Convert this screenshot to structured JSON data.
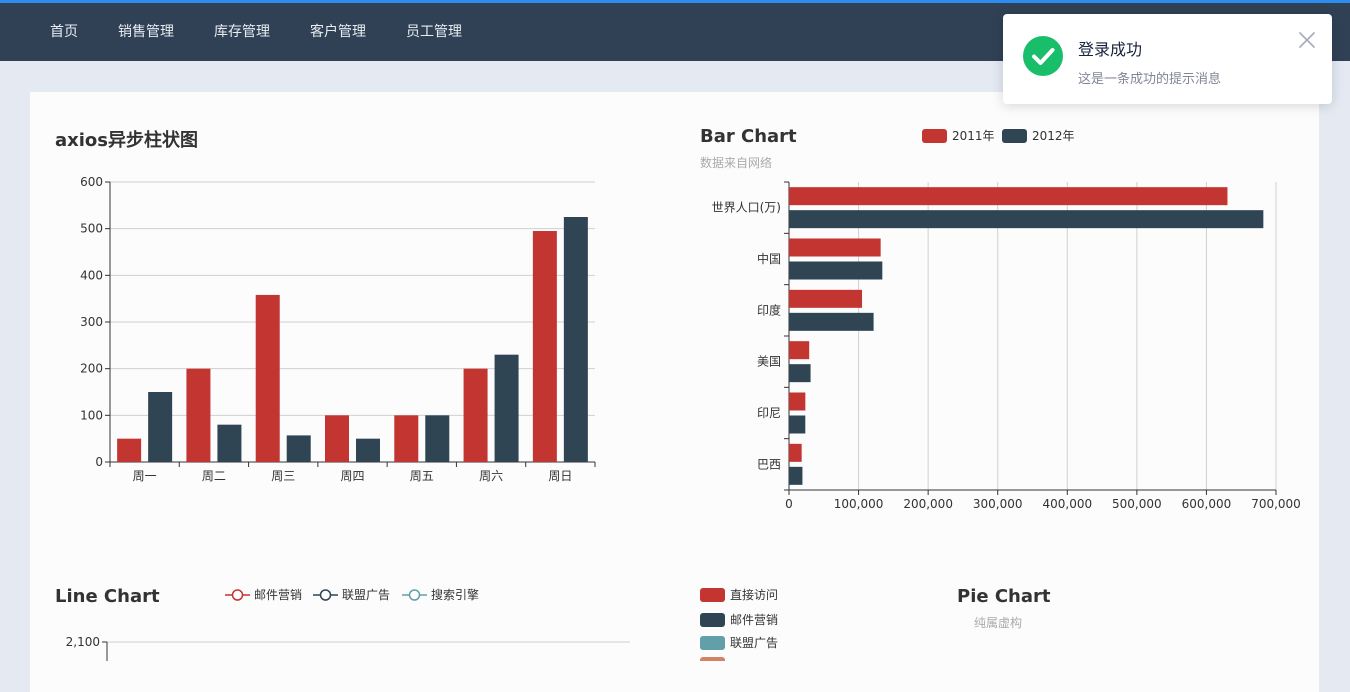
{
  "nav": {
    "items": [
      {
        "label": "首页"
      },
      {
        "label": "销售管理"
      },
      {
        "label": "库存管理"
      },
      {
        "label": "客户管理"
      },
      {
        "label": "员工管理"
      }
    ]
  },
  "toast": {
    "title": "登录成功",
    "desc": "这是一条成功的提示消息",
    "icon": "checkmark-circle-icon",
    "close_icon": "close-icon",
    "color": "#19be6b"
  },
  "colors": {
    "red": "#c23531",
    "navy": "#2f4554",
    "teal": "#61a0a8",
    "nav_bg": "#304156",
    "accent": "#2d8cf0"
  },
  "chart_data": [
    {
      "type": "bar",
      "title": "axios异步柱状图",
      "categories": [
        "周一",
        "周二",
        "周三",
        "周四",
        "周五",
        "周六",
        "周日"
      ],
      "series": [
        {
          "values": [
            50,
            200,
            358,
            100,
            100,
            200,
            495
          ],
          "color": "#c23531"
        },
        {
          "values": [
            150,
            80,
            57,
            50,
            100,
            230,
            525
          ],
          "color": "#2f4554"
        }
      ],
      "ylim": [
        0,
        600
      ],
      "yticks": [
        0,
        100,
        200,
        300,
        400,
        500,
        600
      ],
      "grid": true
    },
    {
      "type": "bar",
      "orientation": "horizontal",
      "title": "Bar Chart",
      "subtitle": "数据来自网络",
      "categories": [
        "巴西",
        "印尼",
        "美国",
        "印度",
        "中国",
        "世界人口(万)"
      ],
      "series": [
        {
          "name": "2011年",
          "values": [
            18203,
            23489,
            29034,
            104970,
            131744,
            630230
          ],
          "color": "#c23531"
        },
        {
          "name": "2012年",
          "values": [
            19325,
            23438,
            31000,
            121594,
            134141,
            681807
          ],
          "color": "#2f4554"
        }
      ],
      "xlim": [
        0,
        700000
      ],
      "xticks": [
        "0",
        "100,000",
        "200,000",
        "300,000",
        "400,000",
        "500,000",
        "600,000",
        "700,000"
      ],
      "legend": "top",
      "grid": true
    },
    {
      "type": "line",
      "title": "Line Chart",
      "series": [
        {
          "name": "邮件营销",
          "color": "#c23531"
        },
        {
          "name": "联盟广告",
          "color": "#2f4554"
        },
        {
          "name": "搜索引擎",
          "color": "#61a0a8"
        }
      ],
      "yticks": [
        "2,100"
      ],
      "legend": "top"
    },
    {
      "type": "pie",
      "title": "Pie Chart",
      "subtitle": "纯属虚构",
      "legend_entries": [
        {
          "name": "直接访问",
          "color": "#c23531"
        },
        {
          "name": "邮件营销",
          "color": "#2f4554"
        },
        {
          "name": "联盟广告",
          "color": "#61a0a8"
        }
      ],
      "legend": "left"
    }
  ]
}
